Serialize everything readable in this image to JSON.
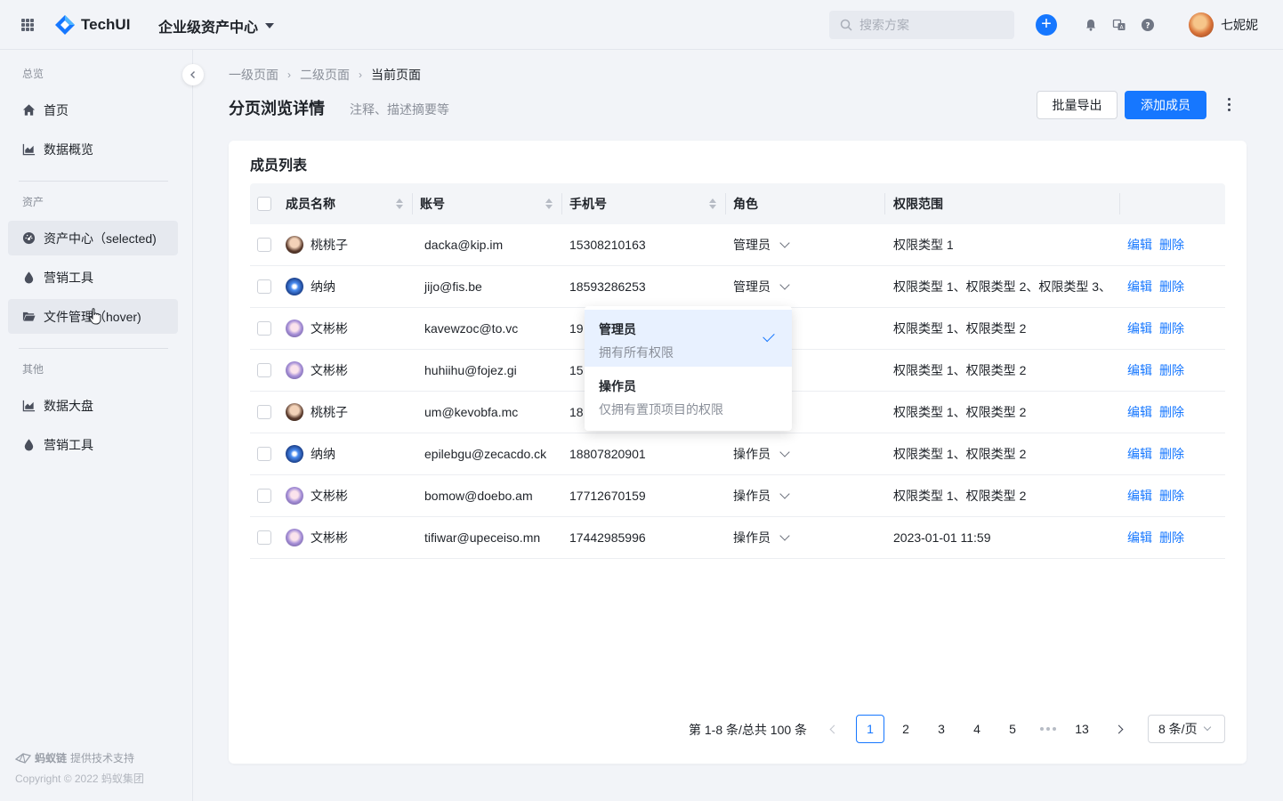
{
  "header": {
    "logo_text": "TechUI",
    "app_name": "企业级资产中心",
    "search_placeholder": "搜索方案",
    "user_name": "七妮妮"
  },
  "sidebar": {
    "groups": [
      {
        "label": "总览"
      },
      {
        "label": "资产"
      },
      {
        "label": "其他"
      }
    ],
    "items": [
      {
        "label": "首页",
        "icon": "home-icon"
      },
      {
        "label": "数据概览",
        "icon": "chart-icon"
      },
      {
        "label": "资产中心（selected)",
        "icon": "dashboard-icon"
      },
      {
        "label": "营销工具",
        "icon": "drop-icon"
      },
      {
        "label": "文件管理（hover)",
        "icon": "folder-icon"
      },
      {
        "label": "数据大盘",
        "icon": "chart-icon"
      },
      {
        "label": "营销工具",
        "icon": "drop-icon"
      }
    ],
    "footer_brand": "蚂蚁链",
    "footer_support": "提供技术支持",
    "footer_copyright": "Copyright © 2022 蚂蚁集团"
  },
  "breadcrumb": [
    "一级页面",
    "二级页面",
    "当前页面"
  ],
  "page": {
    "title": "分页浏览详情",
    "description": "注释、描述摘要等",
    "export_label": "批量导出",
    "add_label": "添加成员"
  },
  "card": {
    "title": "成员列表"
  },
  "table": {
    "columns": [
      "成员名称",
      "账号",
      "手机号",
      "角色",
      "权限范围"
    ],
    "rows": [
      {
        "name": "桃桃子",
        "avatar": "tao",
        "account": "dacka@kip.im",
        "phone": "15308210163",
        "role": "管理员",
        "scope": "权限类型 1"
      },
      {
        "name": "纳纳",
        "avatar": "na",
        "account": "jijo@fis.be",
        "phone": "18593286253",
        "role": "管理员",
        "scope": "权限类型 1、权限类型 2、权限类型 3、"
      },
      {
        "name": "文彬彬",
        "avatar": "wen",
        "account": "kavewzoc@to.vc",
        "phone": "19",
        "role": "",
        "scope": "权限类型 1、权限类型 2"
      },
      {
        "name": "文彬彬",
        "avatar": "wen",
        "account": "huhiihu@fojez.gi",
        "phone": "15",
        "role": "",
        "scope": "权限类型 1、权限类型 2"
      },
      {
        "name": "桃桃子",
        "avatar": "tao",
        "account": "um@kevobfa.mc",
        "phone": "18",
        "role": "",
        "scope": "权限类型 1、权限类型 2"
      },
      {
        "name": "纳纳",
        "avatar": "na",
        "account": "epilebgu@zecacdo.ck",
        "phone": "18807820901",
        "role": "操作员",
        "scope": "权限类型 1、权限类型 2"
      },
      {
        "name": "文彬彬",
        "avatar": "wen",
        "account": "bomow@doebo.am",
        "phone": "17712670159",
        "role": "操作员",
        "scope": "权限类型 1、权限类型 2"
      },
      {
        "name": "文彬彬",
        "avatar": "wen",
        "account": "tifiwar@upeceiso.mn",
        "phone": "17442985996",
        "role": "操作员",
        "scope": "2023-01-01 11:59"
      }
    ],
    "edit_label": "编辑",
    "delete_label": "删除"
  },
  "role_dropdown": {
    "options": [
      {
        "title": "管理员",
        "desc": "拥有所有权限",
        "selected": true
      },
      {
        "title": "操作员",
        "desc": "仅拥有置顶项目的权限",
        "selected": false
      }
    ]
  },
  "pagination": {
    "total_text": "第 1-8 条/总共 100 条",
    "pages": [
      "1",
      "2",
      "3",
      "4",
      "5"
    ],
    "last_page": "13",
    "current": "1",
    "page_size": "8 条/页"
  },
  "colors": {
    "primary": "#1677ff",
    "text": "#1f2329",
    "muted": "#8a8f99"
  }
}
